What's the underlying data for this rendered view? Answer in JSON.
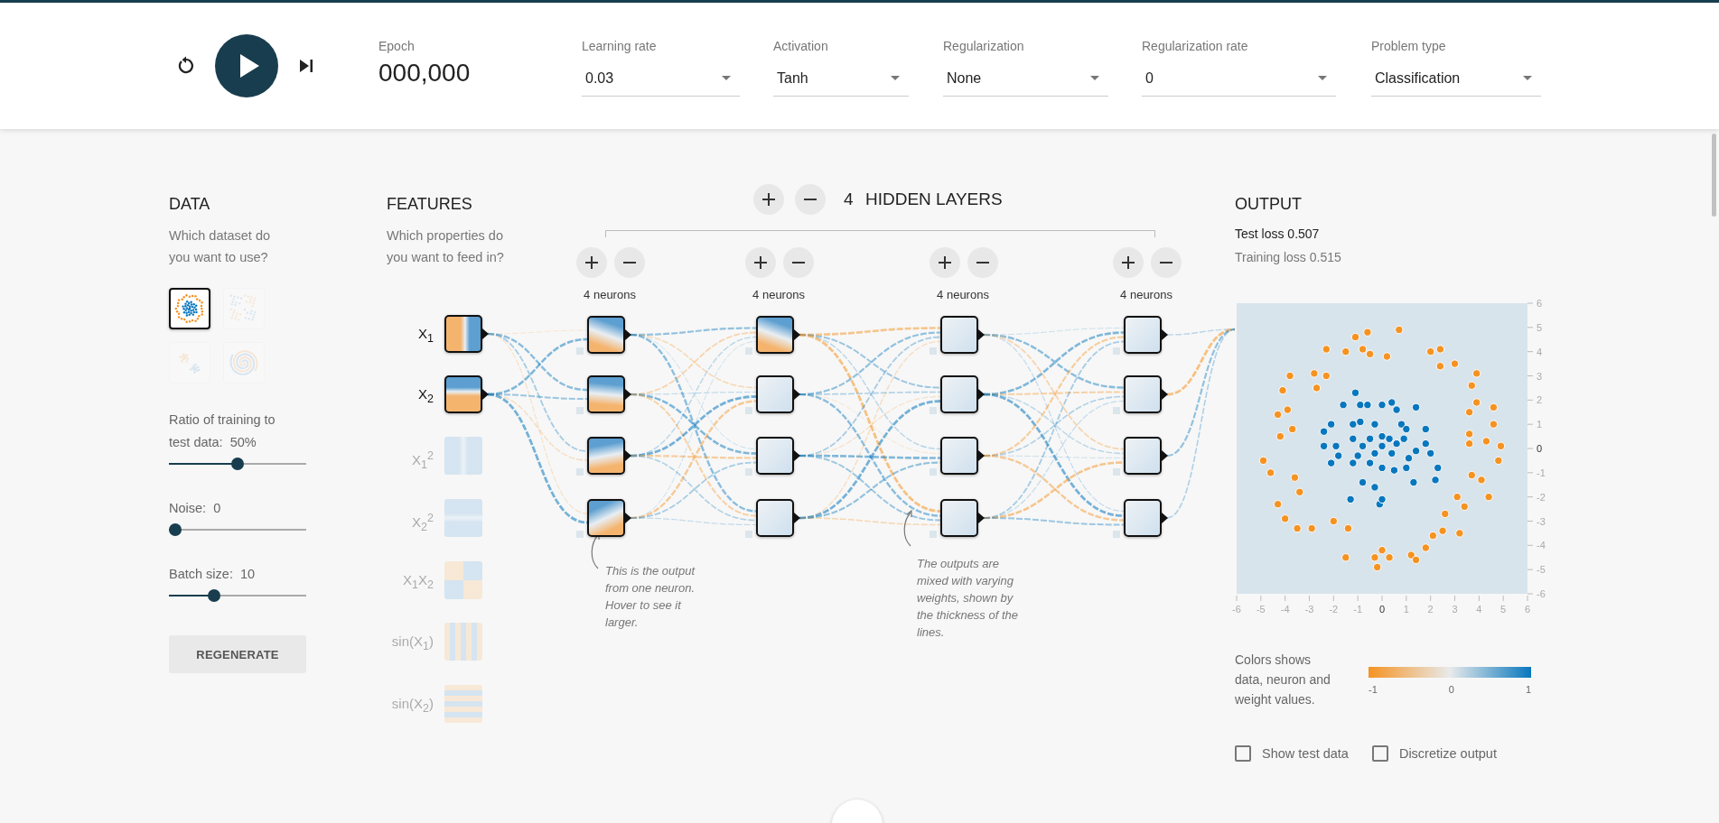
{
  "toolbar": {
    "epoch_label": "Epoch",
    "epoch": "000,000",
    "dropdowns": [
      {
        "label": "Learning rate",
        "value": "0.03"
      },
      {
        "label": "Activation",
        "value": "Tanh"
      },
      {
        "label": "Regularization",
        "value": "None"
      },
      {
        "label": "Regularization rate",
        "value": "0"
      },
      {
        "label": "Problem type",
        "value": "Classification"
      }
    ]
  },
  "data": {
    "title": "DATA",
    "subtitle": "Which dataset do you want to use?",
    "datasets": [
      {
        "kind": "circle",
        "selected": true
      },
      {
        "kind": "xor",
        "selected": false
      },
      {
        "kind": "gauss",
        "selected": false
      },
      {
        "kind": "spiral",
        "selected": false
      }
    ],
    "sliders": [
      {
        "label": "Ratio of training to test data:",
        "value": "50%",
        "level": 0.5
      },
      {
        "label": "Noise:",
        "value": "0",
        "level": 0
      },
      {
        "label": "Batch size:",
        "value": "10",
        "level": 0.31
      }
    ],
    "regenerate": "REGENERATE"
  },
  "features": {
    "title": "FEATURES",
    "subtitle": "Which properties do you want to feed in?",
    "items": [
      {
        "label": "X$_{1}$",
        "kind": "x1",
        "selected": true
      },
      {
        "label": "X$_{2}$",
        "kind": "x2",
        "selected": true
      },
      {
        "label": "X$_{1}$$^{2}$",
        "kind": "x1sq",
        "selected": false
      },
      {
        "label": "X$_{2}$$^{2}$",
        "kind": "x2sq",
        "selected": false
      },
      {
        "label": "X$_{1}$X$_{2}$",
        "kind": "x1x2",
        "selected": false
      },
      {
        "label": "sin(X$_{1}$)",
        "kind": "sin1",
        "selected": false
      },
      {
        "label": "sin(X$_{2}$)",
        "kind": "sin2",
        "selected": false
      }
    ]
  },
  "hidden": {
    "count": "4",
    "title": "HIDDEN LAYERS",
    "layers": [
      {
        "neurons_label": "4 neurons",
        "neurons": [
          {
            "kind": "diagonal"
          },
          {
            "kind": "diagonal"
          },
          {
            "kind": "diagonal"
          },
          {
            "kind": "diagonal"
          }
        ]
      },
      {
        "neurons_label": "4 neurons",
        "neurons": [
          {
            "kind": "diagonal"
          },
          {
            "kind": "faint"
          },
          {
            "kind": "faint"
          },
          {
            "kind": "faint"
          }
        ]
      },
      {
        "neurons_label": "4 neurons",
        "neurons": [
          {
            "kind": "faint"
          },
          {
            "kind": "faint"
          },
          {
            "kind": "faint"
          },
          {
            "kind": "faint"
          }
        ]
      },
      {
        "neurons_label": "4 neurons",
        "neurons": [
          {
            "kind": "faint"
          },
          {
            "kind": "faint"
          },
          {
            "kind": "faint"
          },
          {
            "kind": "faint"
          }
        ]
      }
    ]
  },
  "annotations": [
    {
      "text": "This is the output from one neuron. Hover to see it larger."
    },
    {
      "text": "The outputs are mixed with varying weights, shown by the thickness of the lines."
    }
  ],
  "output": {
    "title": "OUTPUT",
    "test_loss": "Test loss 0.507",
    "training_loss": "Training loss 0.515",
    "chart_data": {
      "type": "scatter",
      "xlim": [
        -6,
        6
      ],
      "ylim": [
        -6,
        6
      ],
      "xticks": [
        -6,
        -5,
        -4,
        -3,
        -2,
        -1,
        0,
        1,
        2,
        3,
        4,
        5,
        6
      ],
      "yticks": [
        6,
        5,
        4,
        3,
        2,
        1,
        0,
        -1,
        -2,
        -3,
        -4,
        -5,
        -6
      ],
      "series": [
        {
          "color": "#f59322",
          "x": [
            -1.1,
            -0.6,
            0.7,
            -1.5,
            -0.8,
            -2.3,
            -2.3,
            -3.8,
            -4.1,
            -3.9,
            -4.3,
            -3.7,
            -4.2,
            -4.9,
            -4.6,
            -3.6,
            -3.4,
            -4.3,
            -4.0,
            -3.5,
            -2.9,
            -2.0,
            -1.4,
            -1.5,
            -0.3,
            -0.2,
            0.0,
            0.3,
            1.2,
            1.4,
            1.8,
            2.1,
            2.5,
            3.2,
            2.6,
            3.1,
            3.4,
            3.7,
            4.1,
            4.4,
            4.8,
            4.9,
            4.3,
            3.6,
            3.6,
            4.6,
            3.6,
            4.6,
            3.9,
            3.7,
            3.9,
            2.4,
            3.0,
            2.0,
            2.4,
            0.2,
            -0.5,
            -2.8,
            -2.7
          ],
          "values": [
            4.6,
            4.8,
            4.9,
            4.0,
            4.1,
            4.1,
            3.0,
            3.0,
            2.4,
            1.6,
            1.4,
            0.8,
            0.5,
            -0.5,
            -1.0,
            -1.2,
            -1.8,
            -2.3,
            -2.9,
            -3.3,
            -3.3,
            -3.0,
            -3.3,
            -4.5,
            -4.5,
            -4.9,
            -4.2,
            -4.5,
            -4.4,
            -4.6,
            -4.1,
            -3.6,
            -3.4,
            -3.5,
            -2.7,
            -2.0,
            -2.4,
            -1.1,
            -1.3,
            -2.0,
            -0.5,
            0.1,
            0.3,
            0.2,
            0.6,
            1.0,
            1.5,
            1.7,
            1.9,
            2.6,
            3.1,
            3.4,
            3.5,
            4.0,
            4.1,
            3.8,
            3.9,
            3.1,
            2.5
          ]
        },
        {
          "color": "#0877bd",
          "x": [
            -1.1,
            -1.6,
            -0.9,
            -0.6,
            0.0,
            0.4,
            0.6,
            1.4,
            -2.1,
            -1.2,
            -0.9,
            -0.3,
            0.8,
            1.0,
            1.8,
            -2.4,
            -1.2,
            -0.5,
            0.0,
            0.3,
            0.9,
            1.8,
            -2.4,
            -1.9,
            -0.8,
            0.0,
            0.6,
            1.4,
            -1.8,
            -1.0,
            -0.3,
            0.4,
            1.1,
            2.0,
            -1.2,
            -0.5,
            0.0,
            0.5,
            1.0,
            -2.1,
            -0.8,
            -0.3,
            1.3,
            2.2,
            2.3,
            -1.3,
            -0.1,
            0.0
          ],
          "values": [
            2.3,
            1.8,
            1.8,
            1.8,
            1.8,
            1.9,
            1.6,
            1.7,
            1.0,
            1.0,
            1.1,
            1.0,
            1.0,
            0.8,
            0.8,
            0.7,
            0.4,
            0.4,
            0.5,
            0.4,
            0.4,
            0.2,
            0.1,
            0.1,
            0.1,
            0.1,
            0.2,
            -0.1,
            -0.3,
            -0.3,
            -0.2,
            -0.2,
            -0.4,
            -0.2,
            -0.6,
            -0.6,
            -0.8,
            -0.9,
            -0.8,
            -0.6,
            -1.4,
            -1.6,
            -1.4,
            -1.3,
            -0.8,
            -2.1,
            -2.3,
            -2.1
          ]
        }
      ]
    },
    "legend": {
      "text": "Colors shows data, neuron and weight values.",
      "ticks": [
        "-1",
        "0",
        "1"
      ]
    },
    "checkboxes": [
      {
        "label": "Show test data",
        "checked": false
      },
      {
        "label": "Discretize output",
        "checked": false
      }
    ]
  }
}
